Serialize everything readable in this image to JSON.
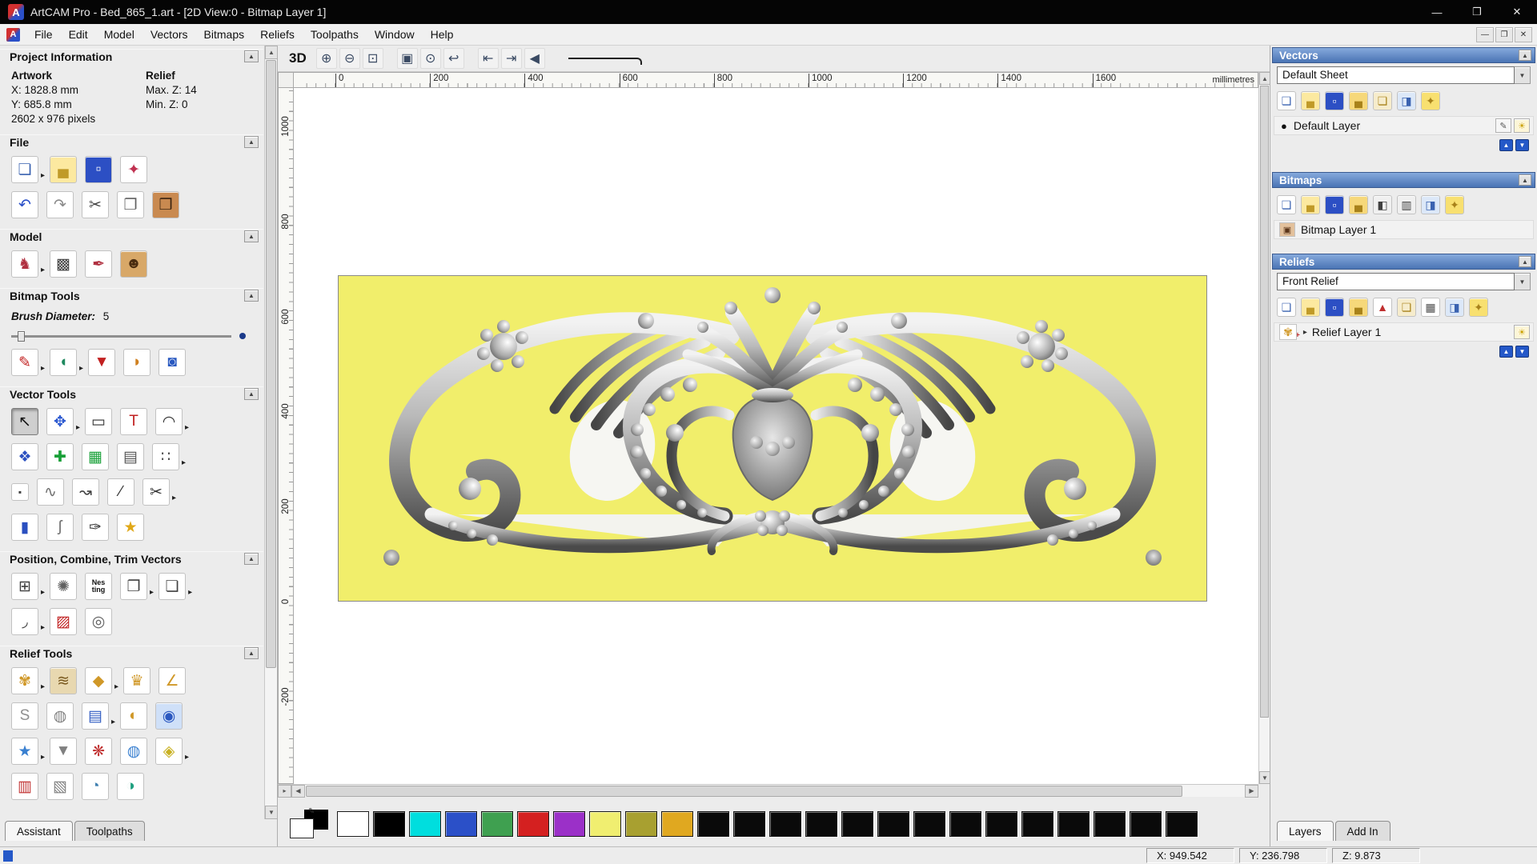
{
  "window": {
    "title": "ArtCAM Pro - Bed_865_1.art - [2D View:0 - Bitmap Layer 1]",
    "app_icon": "A",
    "controls": [
      [
        "minimize",
        "—"
      ],
      [
        "maximize",
        "❐"
      ],
      [
        "close",
        "✕"
      ]
    ]
  },
  "menu": {
    "items": [
      "File",
      "Edit",
      "Model",
      "Vectors",
      "Bitmaps",
      "Reliefs",
      "Toolpaths",
      "Window",
      "Help"
    ],
    "mdi_controls": [
      [
        "mdi-minimize",
        "—"
      ],
      [
        "mdi-restore",
        "❐"
      ],
      [
        "mdi-close",
        "✕"
      ]
    ]
  },
  "ui": {
    "collapse": "▲",
    "dropdown": "▼",
    "up": "▲",
    "down": "▼",
    "left": "◀",
    "right": "▶",
    "nub": "▸",
    "plus": "+",
    "photo": "▣",
    "swirl": "✾",
    "dot": "●",
    "pencil": "✎",
    "bulb": "☀",
    "expander": "▸"
  },
  "left_panel": {
    "project_info": {
      "title": "Project Information",
      "artwork_label": "Artwork",
      "relief_label": "Relief",
      "x": "X: 1828.8 mm",
      "y": "Y: 685.8 mm",
      "pixels": "2602 x 976 pixels",
      "max_z": "Max. Z: 14",
      "min_z": "Min. Z: 0"
    },
    "sections": {
      "file": "File",
      "model": "Model",
      "bitmap_tools": "Bitmap Tools",
      "vector_tools": "Vector Tools",
      "position": "Position, Combine, Trim Vectors",
      "relief_tools": "Relief Tools"
    },
    "brush": {
      "label": "Brush Diameter:",
      "value": "5"
    },
    "tabs": [
      "Assistant",
      "Toolpaths"
    ],
    "icons": {
      "file1": [
        [
          "new-model",
          "❏",
          "#ffffff",
          "#3a62b0",
          "arrow"
        ],
        [
          "open-model",
          "▄",
          "#fce9a0",
          "#c09a28",
          ""
        ],
        [
          "save-model",
          "▫",
          "#2c4fc4",
          "#ffffff",
          ""
        ],
        [
          "import-model",
          "✦",
          "#ffffff",
          "#c03050",
          ""
        ]
      ],
      "file2": [
        [
          "undo",
          "↶",
          "#ffffff",
          "#2b50c8",
          ""
        ],
        [
          "redo",
          "↷",
          "#ffffff",
          "#8a8a8a",
          ""
        ],
        [
          "cut",
          "✂",
          "#ffffff",
          "#404040",
          ""
        ],
        [
          "copy",
          "❐",
          "#ffffff",
          "#606060",
          ""
        ],
        [
          "paste",
          "❒",
          "#c98a50",
          "#3a2410",
          ""
        ]
      ],
      "model": [
        [
          "load-relief",
          "♞",
          "#ffffff",
          "#b03040",
          "arrow"
        ],
        [
          "greyscale-model",
          "▩",
          "#ffffff",
          "#404040",
          ""
        ],
        [
          "sculpt-model",
          "✒",
          "#ffffff",
          "#b03040",
          ""
        ],
        [
          "face-wizard",
          "☻",
          "#d8a868",
          "#4a2c10",
          ""
        ]
      ],
      "paint": [
        [
          "paint-brush",
          "✎",
          "#ffffff",
          "#c22020",
          "arrow"
        ],
        [
          "flood-fill",
          "◖",
          "#ffffff",
          "#208a60",
          "arrow"
        ],
        [
          "colour-picker",
          "▼",
          "#ffffff",
          "#c22020",
          ""
        ],
        [
          "palette",
          "◗",
          "#ffffff",
          "#d08020",
          ""
        ],
        [
          "bucket-fill",
          "◙",
          "#ffffff",
          "#2858c0",
          ""
        ]
      ],
      "vector1": [
        [
          "select-vectors",
          "↖",
          "#cfcfcf",
          "#101010",
          "pressed"
        ],
        [
          "transform-vectors",
          "✥",
          "#ffffff",
          "#2b58d0",
          "arrow"
        ],
        [
          "create-rectangle",
          "▭",
          "#ffffff",
          "#303030",
          ""
        ],
        [
          "create-text",
          "T",
          "#ffffff",
          "#c02020",
          ""
        ],
        [
          "measure-tool",
          "◠",
          "#ffffff",
          "#303030",
          "arrow"
        ]
      ],
      "vector2": [
        [
          "vector-offset",
          "❖",
          "#ffffff",
          "#2b50c0",
          ""
        ],
        [
          "vector-doctor",
          "✚",
          "#ffffff",
          "#18a038",
          ""
        ],
        [
          "text-panel",
          "▦",
          "#ffffff",
          "#18a038",
          ""
        ],
        [
          "grid-tool",
          "▤",
          "#ffffff",
          "#505050",
          ""
        ],
        [
          "snap-points",
          "∷",
          "#ffffff",
          "#505050",
          "arrow"
        ]
      ],
      "vector3": [
        [
          "point-tool",
          "▪",
          "#ffffff",
          "#404040",
          "small"
        ],
        [
          "freehand-curve",
          "∿",
          "#ffffff",
          "#707070",
          ""
        ],
        [
          "bezier-curve",
          "↝",
          "#ffffff",
          "#404040",
          ""
        ],
        [
          "polyline-tool",
          "∕",
          "#ffffff",
          "#303030",
          ""
        ],
        [
          "node-editing",
          "✂",
          "#ffffff",
          "#303030",
          "arrow"
        ]
      ],
      "vector4": [
        [
          "create-cylinder",
          "▮",
          "#ffffff",
          "#2b50c0",
          ""
        ],
        [
          "arc-tool",
          "ʃ",
          "#ffffff",
          "#707070",
          ""
        ],
        [
          "pen-tool",
          "✑",
          "#ffffff",
          "#303030",
          ""
        ],
        [
          "vector-wizard",
          "★",
          "#ffffff",
          "#e0a818",
          ""
        ]
      ],
      "position1": [
        [
          "align-vectors",
          "⊞",
          "#ffffff",
          "#404040",
          "arrow"
        ],
        [
          "circular-copy",
          "✺",
          "#ffffff",
          "#606060",
          ""
        ],
        [
          "nesting",
          "Nes ting",
          "#ffffff",
          "#101010",
          "txt"
        ],
        [
          "block-copy",
          "❐",
          "#ffffff",
          "#404040",
          "arrow"
        ],
        [
          "copy-along-curve",
          "❏",
          "#ffffff",
          "#404040",
          "arrow"
        ]
      ],
      "position2": [
        [
          "trim-vectors",
          "◞",
          "#ffffff",
          "#404040",
          "arrow"
        ],
        [
          "weld-vectors",
          "▨",
          "#ffffff",
          "#c02020",
          ""
        ],
        [
          "spiral-tool",
          "◎",
          "#ffffff",
          "#606060",
          ""
        ]
      ],
      "relief1": [
        [
          "shape-editor",
          "✾",
          "#ffffff",
          "#d09828",
          "arrow"
        ],
        [
          "smooth-relief",
          "≋",
          "#e8d8b0",
          "#7a5a20",
          ""
        ],
        [
          "dome-relief",
          "◆",
          "#ffffff",
          "#d09828",
          "arrow"
        ],
        [
          "texture-relief",
          "♛",
          "#ffffff",
          "#d09828",
          ""
        ],
        [
          "angled-plane",
          "∠",
          "#ffffff",
          "#d09828",
          ""
        ]
      ],
      "relief2": [
        [
          "sculpt-relief",
          "S",
          "#ffffff",
          "#909090",
          ""
        ],
        [
          "weave-wizard",
          "◍",
          "#ffffff",
          "#808080",
          ""
        ],
        [
          "relief-layer-tool",
          "▤",
          "#ffffff",
          "#2b58c0",
          "arrow"
        ],
        [
          "two-rail-sweep",
          "◐",
          "#ffffff",
          "#d09828",
          ""
        ],
        [
          "relief-envelope",
          "◉",
          "#cfe0f8",
          "#2b58c0",
          ""
        ]
      ],
      "relief3": [
        [
          "star-wizard",
          "★",
          "#ffffff",
          "#3a80d0",
          "arrow"
        ],
        [
          "envelope-distort",
          "▼",
          "#ffffff",
          "#808080",
          ""
        ],
        [
          "turn-relief",
          "❋",
          "#ffffff",
          "#c03030",
          ""
        ],
        [
          "texture-sphere",
          "◍",
          "#ffffff",
          "#3a80d0",
          ""
        ],
        [
          "flatten-relief",
          "◈",
          "#ffffff",
          "#c8b020",
          "arrow"
        ]
      ],
      "relief4": [
        [
          "clip-relief",
          "▥",
          "#ffffff",
          "#c03030",
          ""
        ],
        [
          "scale-relief",
          "▧",
          "#ffffff",
          "#808080",
          ""
        ],
        [
          "offset-relief",
          "◔",
          "#ffffff",
          "#4080b0",
          ""
        ],
        [
          "mirror-relief",
          "◑",
          "#ffffff",
          "#20a080",
          ""
        ]
      ]
    }
  },
  "canvas": {
    "view_3d": "3D",
    "toolbar_buttons": [
      [
        "zoom-in",
        "⊕",
        ""
      ],
      [
        "zoom-out",
        "⊖",
        ""
      ],
      [
        "zoom-window",
        "⊡",
        ""
      ],
      [
        "zoom-fit",
        "▣",
        "gap"
      ],
      [
        "zoom-1to1",
        "⊙",
        ""
      ],
      [
        "zoom-previous",
        "↩",
        ""
      ],
      [
        "pan-left",
        "⇤",
        "gap"
      ],
      [
        "pan-right",
        "⇥",
        ""
      ],
      [
        "zoom-back",
        "◀",
        ""
      ]
    ],
    "ruler_h": [
      "0",
      "200",
      "400",
      "600",
      "800",
      "1000",
      "1200",
      "1400",
      "1600"
    ],
    "ruler_unit": "millimetres",
    "ruler_v": [
      "1000",
      "800",
      "600",
      "400",
      "200",
      "0",
      "-200"
    ]
  },
  "right_panel": {
    "vectors": {
      "title": "Vectors",
      "sheet": "Default Sheet",
      "layer": "Default Layer"
    },
    "bitmaps": {
      "title": "Bitmaps",
      "layer": "Bitmap Layer 1"
    },
    "reliefs": {
      "title": "Reliefs",
      "relief": "Front Relief",
      "layer": "Relief Layer 1"
    },
    "tabs": [
      "Layers",
      "Add In"
    ],
    "toolbars": {
      "vectors": [
        [
          "new-vector-layer",
          "❏",
          "#ffffff",
          "#3a62b0",
          ""
        ],
        [
          "open-vector-file",
          "▄",
          "#fce9a0",
          "#c09a28",
          ""
        ],
        [
          "save-vector-layer",
          "▫",
          "#2c4fc4",
          "#ffffff",
          ""
        ],
        [
          "import-vectors",
          "▄",
          "#f6d87a",
          "#a8821a",
          ""
        ],
        [
          "export-vectors",
          "❏",
          "#f6eccc",
          "#a8821a",
          ""
        ],
        [
          "clear-vector-layer",
          "◨",
          "#dce8f8",
          "#3a62b0",
          ""
        ],
        [
          "merge-vector-layers",
          "✦",
          "#f8e070",
          "#a8821a",
          ""
        ]
      ],
      "bitmaps": [
        [
          "new-bitmap-layer",
          "❏",
          "#ffffff",
          "#3a62b0",
          ""
        ],
        [
          "open-bitmap-file",
          "▄",
          "#fce9a0",
          "#c09a28",
          ""
        ],
        [
          "save-bitmap-layer",
          "▫",
          "#2c4fc4",
          "#ffffff",
          ""
        ],
        [
          "import-bitmap",
          "▄",
          "#f6d87a",
          "#a8821a",
          ""
        ],
        [
          "bitmap-contrast",
          "◧",
          "#f0f0f0",
          "#404040",
          ""
        ],
        [
          "bitmap-adjust",
          "▥",
          "#f0f0f0",
          "#404040",
          ""
        ],
        [
          "clear-bitmap-layer",
          "◨",
          "#dce8f8",
          "#3a62b0",
          ""
        ],
        [
          "merge-bitmap-layers",
          "✦",
          "#f8e070",
          "#a8821a",
          ""
        ]
      ],
      "reliefs": [
        [
          "new-relief-layer",
          "❏",
          "#ffffff",
          "#3a62b0",
          ""
        ],
        [
          "open-relief-file",
          "▄",
          "#fce9a0",
          "#c09a28",
          ""
        ],
        [
          "save-relief-layer",
          "▫",
          "#2c4fc4",
          "#ffffff",
          ""
        ],
        [
          "import-relief",
          "▄",
          "#f6d87a",
          "#a8821a",
          ""
        ],
        [
          "relief-pyramid",
          "▲",
          "#ffffff",
          "#c03030",
          ""
        ],
        [
          "relief-sheet",
          "❏",
          "#f6eccc",
          "#a8821a",
          ""
        ],
        [
          "relief-grid",
          "▦",
          "#ffffff",
          "#505050",
          ""
        ],
        [
          "clear-relief-layer",
          "◨",
          "#dce8f8",
          "#3a62b0",
          ""
        ],
        [
          "merge-relief-layers",
          "✦",
          "#f8e070",
          "#a8821a",
          ""
        ]
      ]
    }
  },
  "palette": {
    "colors": [
      "#ffffff",
      "#000000",
      "#00dede",
      "#2b50c8",
      "#3fa050",
      "#d42020",
      "#9b30c8",
      "#f0ee70",
      "#a8a030",
      "#e0a820",
      "#0a0a0a",
      "#0a0a0a",
      "#0a0a0a",
      "#0a0a0a",
      "#0a0a0a",
      "#0a0a0a",
      "#0a0a0a",
      "#0a0a0a",
      "#0a0a0a",
      "#0a0a0a",
      "#0a0a0a",
      "#0a0a0a",
      "#0a0a0a",
      "#0a0a0a"
    ]
  },
  "status": {
    "x": "X: 949.542",
    "y": "Y: 236.798",
    "z": "Z: 9.873"
  }
}
